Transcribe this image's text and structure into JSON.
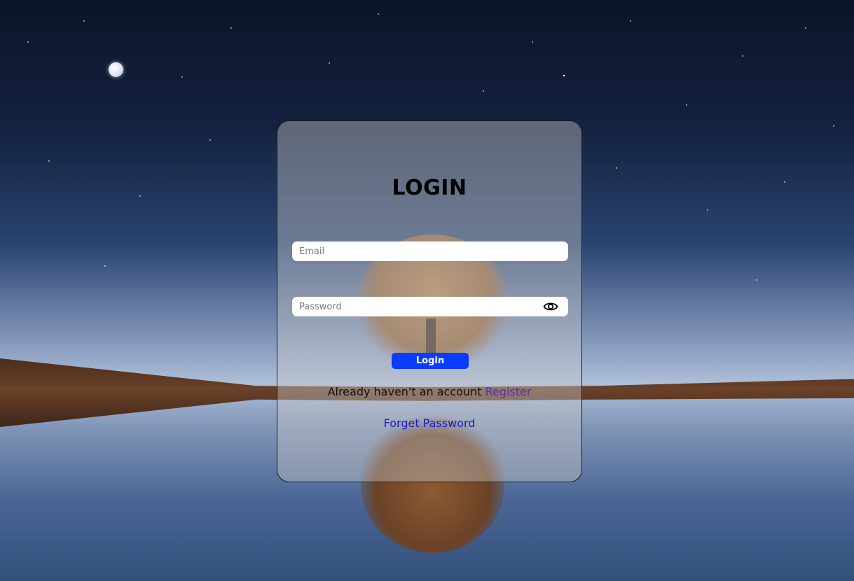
{
  "login_form": {
    "title": "LOGIN",
    "email_placeholder": "Email",
    "password_placeholder": "Password",
    "password_toggle_icon": "eye-icon",
    "submit_label": "Login",
    "register_prompt": "Already haven't an account",
    "register_link": "Register",
    "forget_password_link": "Forget Password"
  },
  "colors": {
    "button_bg": "#0a3cff",
    "register_link": "#5a2ea6",
    "forget_link": "#1a17d6"
  }
}
